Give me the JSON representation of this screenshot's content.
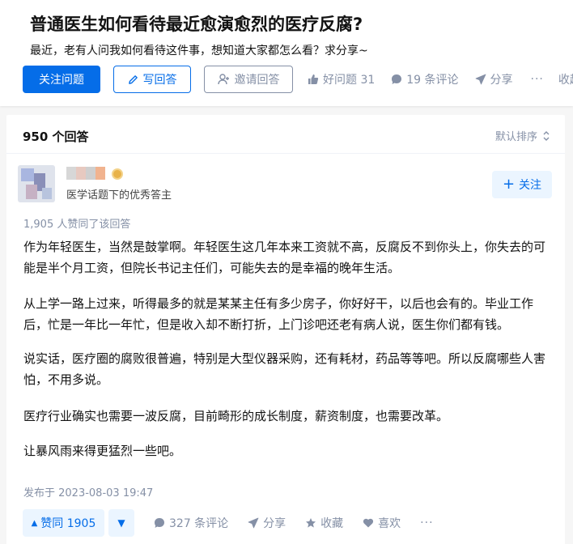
{
  "question": {
    "title": "普通医生如何看待最近愈演愈烈的医疗反腐?",
    "description": "最近，老有人问我如何看待这件事，想知道大家都怎么看？求分享~"
  },
  "question_actions": {
    "follow_label": "关注问题",
    "write_label": "写回答",
    "invite_label": "邀请回答",
    "good_question_label": "好问题 31",
    "comments_label": "19 条评论",
    "share_label": "分享",
    "more_label": "···",
    "collapse_label": "收起"
  },
  "answers": {
    "count_label": "950 个回答",
    "sort_label": "默认排序"
  },
  "answer": {
    "author_desc": "医学话题下的优秀答主",
    "follow_label": "关注",
    "upvoted_text": "1,905 人赞同了该回答",
    "paragraphs": [
      "作为年轻医生，当然是鼓掌啊。年轻医生这几年本来工资就不高，反腐反不到你头上，你失去的可能是半个月工资，但院长书记主任们，可能失去的是幸福的晚年生活。",
      "从上学一路上过来，听得最多的就是某某主任有多少房子，你好好干，以后也会有的。毕业工作后，忙是一年比一年忙，但是收入却不断打折，上门诊吧还老有病人说，医生你们都有钱。",
      "说实话，医疗圈的腐败很普遍，特别是大型仪器采购，还有耗材，药品等等吧。所以反腐哪些人害怕，不用多说。",
      "医疗行业确实也需要一波反腐，目前畸形的成长制度，薪资制度，也需要改革。",
      "让暴风雨来得更猛烈一些吧。"
    ],
    "published": "发布于 2023-08-03 19:47",
    "vote_label": "赞同 1905",
    "comments_label": "327 条评论",
    "share_label": "分享",
    "collect_label": "收藏",
    "like_label": "喜欢",
    "more_label": "···"
  },
  "colors": {
    "accent": "#056de8",
    "muted": "#8590a6"
  }
}
